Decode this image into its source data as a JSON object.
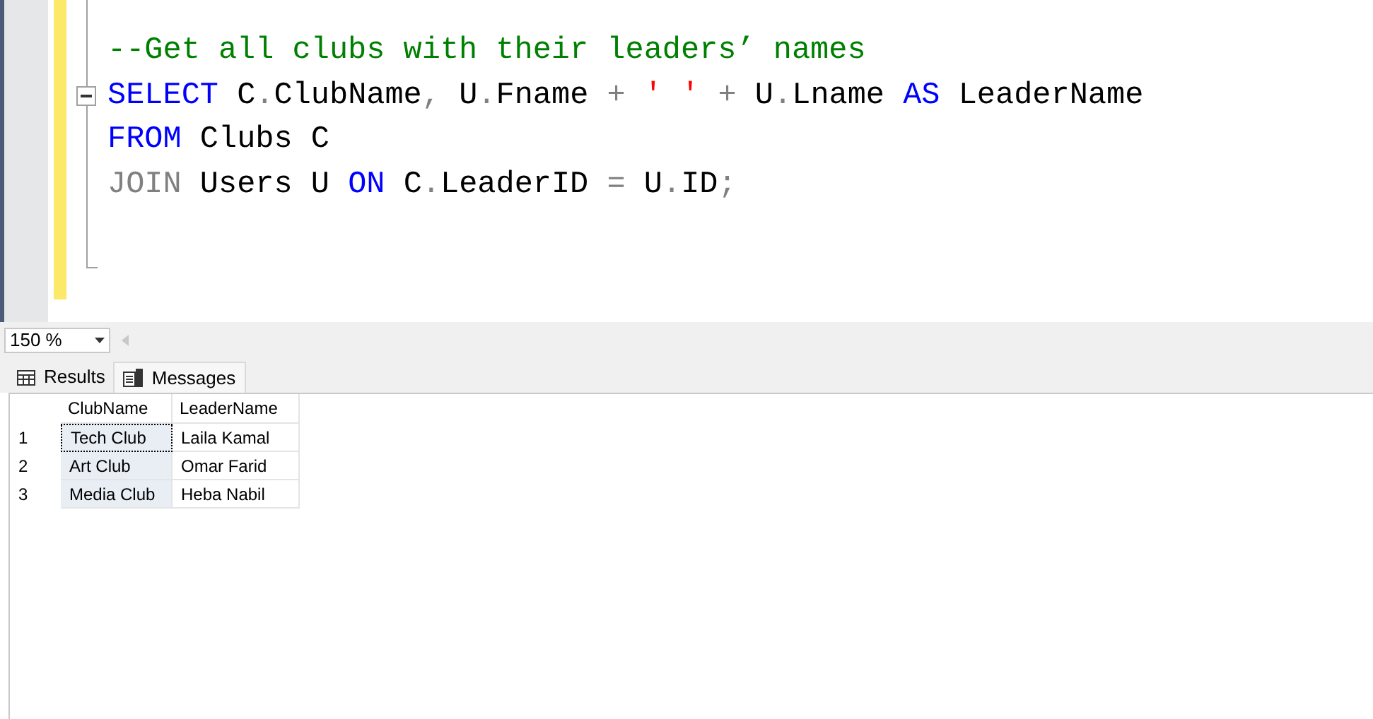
{
  "editor": {
    "lines": [
      {
        "collapsible": false
      },
      {
        "collapsible": false,
        "tokens": [
          {
            "kind": "comment",
            "text": "--Get all clubs with their leaders’ names"
          }
        ]
      },
      {
        "collapsible": true,
        "tokens": [
          {
            "kind": "keyword",
            "text": "SELECT"
          },
          {
            "kind": "text",
            "text": " C"
          },
          {
            "kind": "operator",
            "text": "."
          },
          {
            "kind": "text",
            "text": "ClubName"
          },
          {
            "kind": "operator",
            "text": ","
          },
          {
            "kind": "text",
            "text": " U"
          },
          {
            "kind": "operator",
            "text": "."
          },
          {
            "kind": "text",
            "text": "Fname "
          },
          {
            "kind": "operator",
            "text": "+"
          },
          {
            "kind": "string",
            "text": " ' ' "
          },
          {
            "kind": "operator",
            "text": "+"
          },
          {
            "kind": "text",
            "text": " U"
          },
          {
            "kind": "operator",
            "text": "."
          },
          {
            "kind": "text",
            "text": "Lname "
          },
          {
            "kind": "keyword",
            "text": "AS"
          },
          {
            "kind": "text",
            "text": " LeaderName"
          }
        ]
      },
      {
        "collapsible": false,
        "tokens": [
          {
            "kind": "keyword",
            "text": "FROM"
          },
          {
            "kind": "text",
            "text": " Clubs C"
          }
        ]
      },
      {
        "collapsible": false,
        "tokens": [
          {
            "kind": "operator",
            "text": "JOIN"
          },
          {
            "kind": "text",
            "text": " Users U "
          },
          {
            "kind": "keyword",
            "text": "ON"
          },
          {
            "kind": "text",
            "text": " C"
          },
          {
            "kind": "operator",
            "text": "."
          },
          {
            "kind": "text",
            "text": "LeaderID "
          },
          {
            "kind": "operator",
            "text": "="
          },
          {
            "kind": "text",
            "text": " U"
          },
          {
            "kind": "operator",
            "text": "."
          },
          {
            "kind": "text",
            "text": "ID"
          },
          {
            "kind": "operator",
            "text": ";"
          }
        ]
      },
      {
        "collapsible": false
      }
    ]
  },
  "zoom": {
    "value": "150 %"
  },
  "tabs": [
    {
      "label": "Results",
      "selected": true
    },
    {
      "label": "Messages",
      "selected": false
    }
  ],
  "results": {
    "columns": [
      {
        "name": "ClubName",
        "highlighted": true
      },
      {
        "name": "LeaderName",
        "highlighted": false
      }
    ],
    "rows": [
      {
        "number": "1",
        "cells": [
          {
            "text": "Tech Club",
            "focused": true
          },
          {
            "text": "Laila Kamal",
            "focused": false
          }
        ]
      },
      {
        "number": "2",
        "cells": [
          {
            "text": "Art Club",
            "focused": false
          },
          {
            "text": "Omar Farid",
            "focused": false
          }
        ]
      },
      {
        "number": "3",
        "cells": [
          {
            "text": "Media Club",
            "focused": false
          },
          {
            "text": "Heba Nabil",
            "focused": false
          }
        ]
      }
    ]
  }
}
